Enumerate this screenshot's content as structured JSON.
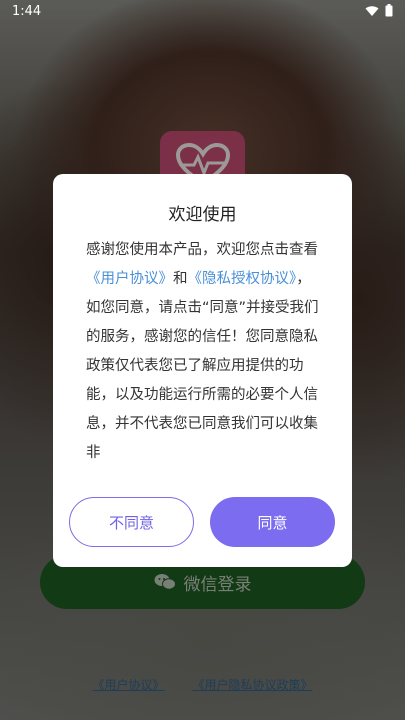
{
  "status_bar": {
    "time": "1:44",
    "wifi_icon": "wifi-icon",
    "battery_icon": "battery-icon"
  },
  "background": {
    "logo_icon": "heart-pulse-icon",
    "login_button": {
      "icon": "wechat-icon",
      "label": "微信登录"
    },
    "links": {
      "user_agreement": "《用户协议》",
      "privacy_policy": "《用户隐私协议政策》"
    }
  },
  "dialog": {
    "title": "欢迎使用",
    "body": {
      "text_1": "感谢您使用本产品，欢迎您点击查看",
      "link_user_agreement": "《用户协议》",
      "text_2": "和",
      "link_privacy": "《隐私授权协议》",
      "text_3": "，如您同意，请点击“同意”并接受我们的服务，感谢您的信任！您同意隐私政策仅代表您已了解应用提供的功能，以及功能运行所需的必要个人信息，并不代表您已同意我们可以收集非"
    },
    "disagree_label": "不同意",
    "agree_label": "同意"
  },
  "colors": {
    "accent": "#7b6cf0",
    "link": "#4a8fd8",
    "wechat_button": "#1d5a1f"
  }
}
